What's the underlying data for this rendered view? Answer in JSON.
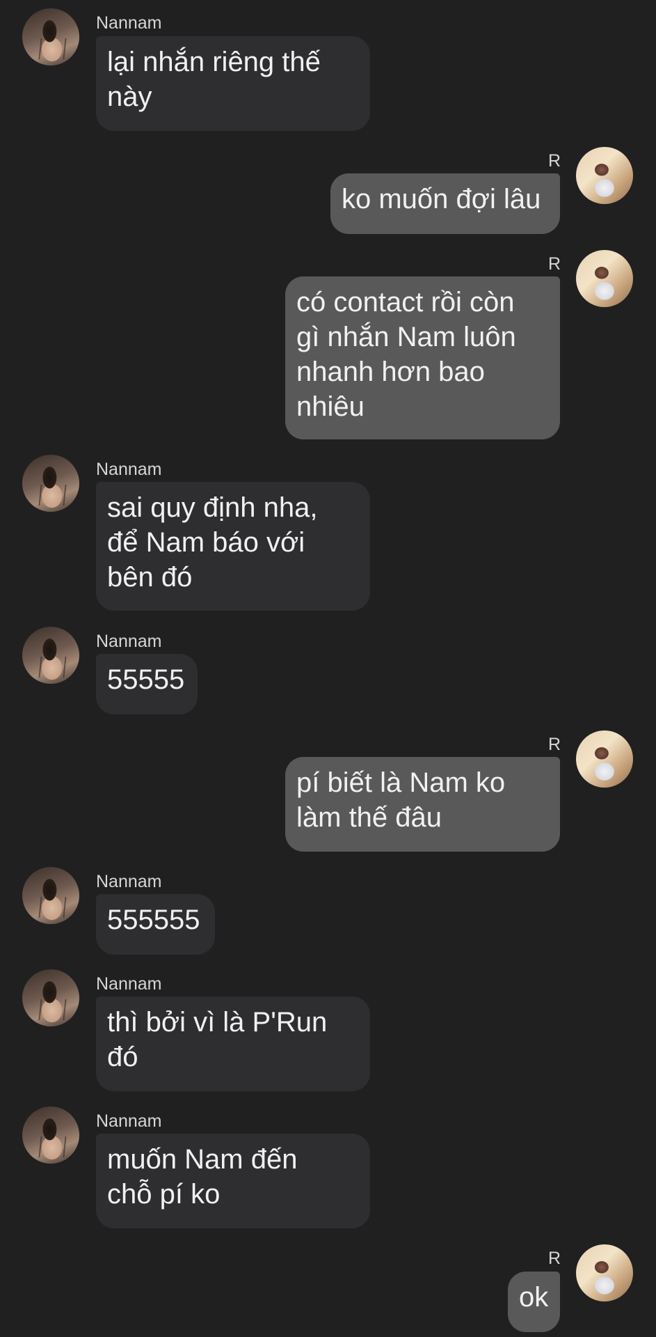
{
  "conversation": {
    "messages": [
      {
        "sender": "Nannam",
        "direction": "incoming",
        "text": "lại nhắn riêng thế\nnày"
      },
      {
        "sender": "R",
        "direction": "outgoing",
        "text": "ko muốn đợi lâu"
      },
      {
        "sender": "R",
        "direction": "outgoing",
        "text": "có contact rồi còn\ngì nhắn Nam luôn\nnhanh hơn bao\nnhiêu"
      },
      {
        "sender": "Nannam",
        "direction": "incoming",
        "text": "sai quy định nha,\nđể Nam báo với\nbên đó"
      },
      {
        "sender": "Nannam",
        "direction": "incoming",
        "text": "55555"
      },
      {
        "sender": "R",
        "direction": "outgoing",
        "text": "pí biết là Nam ko\nlàm thế đâu"
      },
      {
        "sender": "Nannam",
        "direction": "incoming",
        "text": "555555"
      },
      {
        "sender": "Nannam",
        "direction": "incoming",
        "text": "thì bởi vì là P'Run\nđó"
      },
      {
        "sender": "Nannam",
        "direction": "incoming",
        "text": "muốn Nam đến\nchỗ pí ko"
      },
      {
        "sender": "R",
        "direction": "outgoing",
        "text": "ok"
      }
    ]
  },
  "colors": {
    "background": "#202021",
    "incoming_bubble": "#2e2e30",
    "outgoing_bubble": "#595959",
    "text": "#f1f1f1",
    "sender_name": "#d6d6d6"
  },
  "icons": {
    "incoming_avatar": "avatar-nannam-photo",
    "outgoing_avatar": "avatar-r-photo"
  }
}
